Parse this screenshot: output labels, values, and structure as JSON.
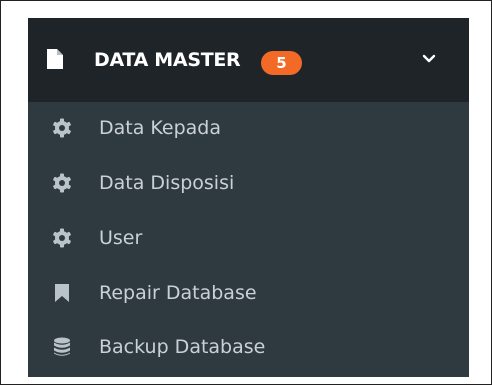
{
  "menu_group": {
    "title": "DATA MASTER",
    "badge": "5",
    "icon": "file-icon",
    "toggle_icon": "chevron-down-icon",
    "colors": {
      "header_bg": "#1f2429",
      "panel_bg": "#2f3a40",
      "badge_bg": "#f26a25",
      "item_text": "#c9d1d6"
    },
    "items": [
      {
        "label": "Data Kepada",
        "icon": "gear-icon"
      },
      {
        "label": "Data Disposisi",
        "icon": "gear-icon"
      },
      {
        "label": "User",
        "icon": "gear-icon"
      },
      {
        "label": "Repair Database",
        "icon": "bookmark-icon"
      },
      {
        "label": "Backup Database",
        "icon": "database-icon"
      }
    ]
  }
}
